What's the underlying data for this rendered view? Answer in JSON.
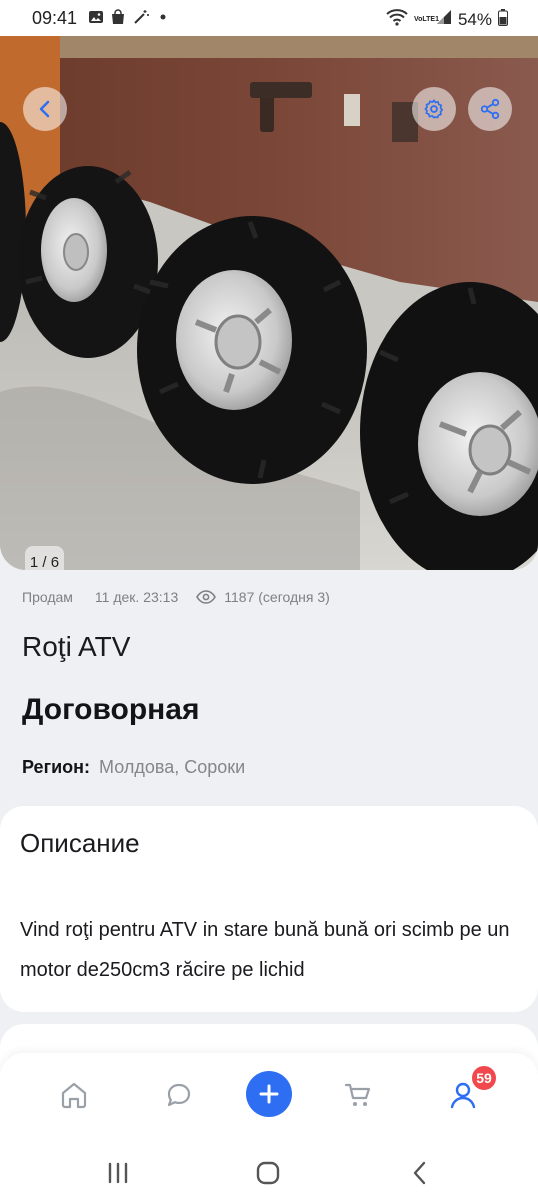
{
  "status_bar": {
    "time": "09:41",
    "battery": "54%",
    "network_label": "VoLTE1",
    "icons": [
      "gallery-icon",
      "bag-icon",
      "magic-wand-icon",
      "dot-icon",
      "wifi-icon",
      "signal-icon",
      "battery-icon"
    ]
  },
  "gallery": {
    "counter": "1 / 6",
    "icons": [
      "back-arrow-icon",
      "settings-gear-icon",
      "share-icon"
    ]
  },
  "listing": {
    "type": "Продам",
    "date": "11 дек. 23:13",
    "views": "1187 (сегодня 3)",
    "title": "Roţi ATV",
    "price": "Договорная",
    "region_label": "Регион:",
    "region_value": "Молдова, Сороки"
  },
  "description": {
    "heading": "Описание",
    "text": "Vind roţi pentru ATV in stare bună bună ori scimb pe un motor de250cm3 răcire pe lichid"
  },
  "bottom_nav": {
    "items": [
      "home-icon",
      "chat-icon",
      "add-icon",
      "cart-icon",
      "profile-icon"
    ],
    "profile_badge": "59",
    "accent": "#2d6ef2",
    "badge_color": "#f0484c"
  },
  "system_nav": {
    "items": [
      "recents-icon",
      "home-circle-icon",
      "back-chevron-icon"
    ]
  }
}
